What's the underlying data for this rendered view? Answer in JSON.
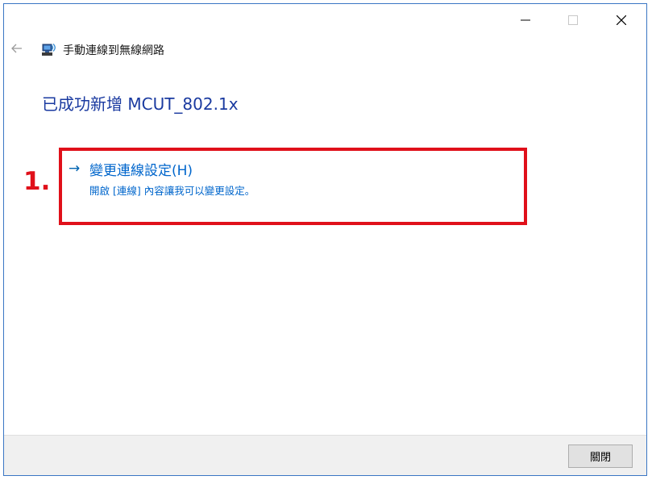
{
  "window": {
    "nav_title": "手動連線到無線網路",
    "icons": {
      "minimize": "minimize-icon",
      "maximize": "maximize-icon",
      "close": "close-icon",
      "back": "back-arrow-icon",
      "network": "network-icon"
    }
  },
  "main": {
    "heading": "已成功新增 MCUT_802.1x",
    "option": {
      "arrow": "→",
      "title": "變更連線設定(H)",
      "description": "開啟 [連線] 內容讓我可以變更設定。"
    },
    "annotation_label": "1."
  },
  "footer": {
    "close_label": "關閉"
  },
  "colors": {
    "accent_link": "#0066cc",
    "heading": "#1a3aa0",
    "annotation": "#e0101a",
    "window_border": "#3a76c4"
  }
}
